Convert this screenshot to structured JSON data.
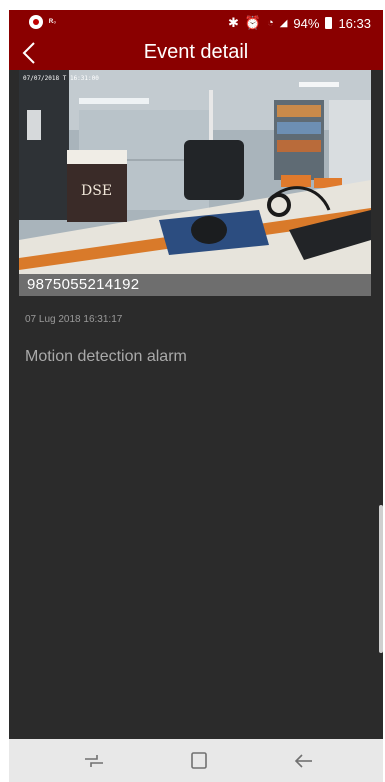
{
  "status_bar": {
    "left_icons": [
      "record-icon",
      "notification-icon"
    ],
    "right_icons": [
      "bluetooth-icon",
      "alarm-icon",
      "wifi-icon",
      "signal-icon",
      "battery-icon"
    ],
    "battery": "94%",
    "time": "16:33"
  },
  "header": {
    "title": "Event detail",
    "back_icon": "chevron-left-icon"
  },
  "snapshot": {
    "overlay_timestamp": "07/07/2018 T 16:31:00",
    "box_label": "DSE"
  },
  "event": {
    "device_id": "9875055214192",
    "datetime": "07 Lug 2018 16:31:17",
    "type": "Motion detection alarm"
  },
  "nav_bar": {
    "recents_icon": "recents-icon",
    "home_icon": "home-icon",
    "back_icon": "back-arrow-icon"
  },
  "colors": {
    "header": "#8a0000",
    "background": "#2b2b2b",
    "id_bar": "#6e6e6e",
    "nav_bar": "#e8e8e8"
  }
}
